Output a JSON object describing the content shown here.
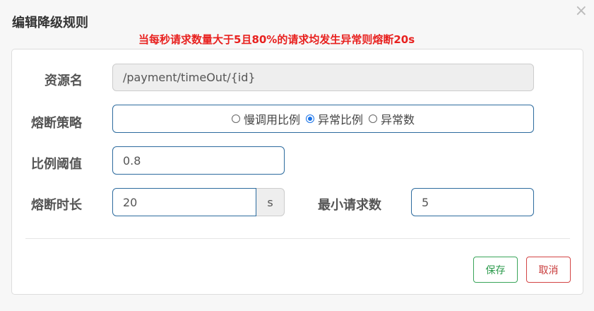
{
  "dialog": {
    "title": "编辑降级规则",
    "close_symbol": "×"
  },
  "annotation": "当每秒请求数量大于5且80%的请求均发生异常则熔断20s",
  "form": {
    "resource": {
      "label": "资源名",
      "value": "/payment/timeOut/{id}"
    },
    "strategy": {
      "label": "熔断策略",
      "options": [
        "慢调用比例",
        "异常比例",
        "异常数"
      ],
      "selected": "异常比例"
    },
    "ratio": {
      "label": "比例阈值",
      "value": "0.8"
    },
    "duration": {
      "label": "熔断时长",
      "value": "20",
      "unit": "s"
    },
    "min_requests": {
      "label": "最小请求数",
      "value": "5"
    }
  },
  "buttons": {
    "save": "保存",
    "cancel": "取消"
  },
  "colors": {
    "annotation": "#e8211f",
    "input_border": "#2d6b9e",
    "radio_selected": "#1a73e8",
    "save": "#2e9b4e",
    "cancel": "#c83a3a"
  }
}
